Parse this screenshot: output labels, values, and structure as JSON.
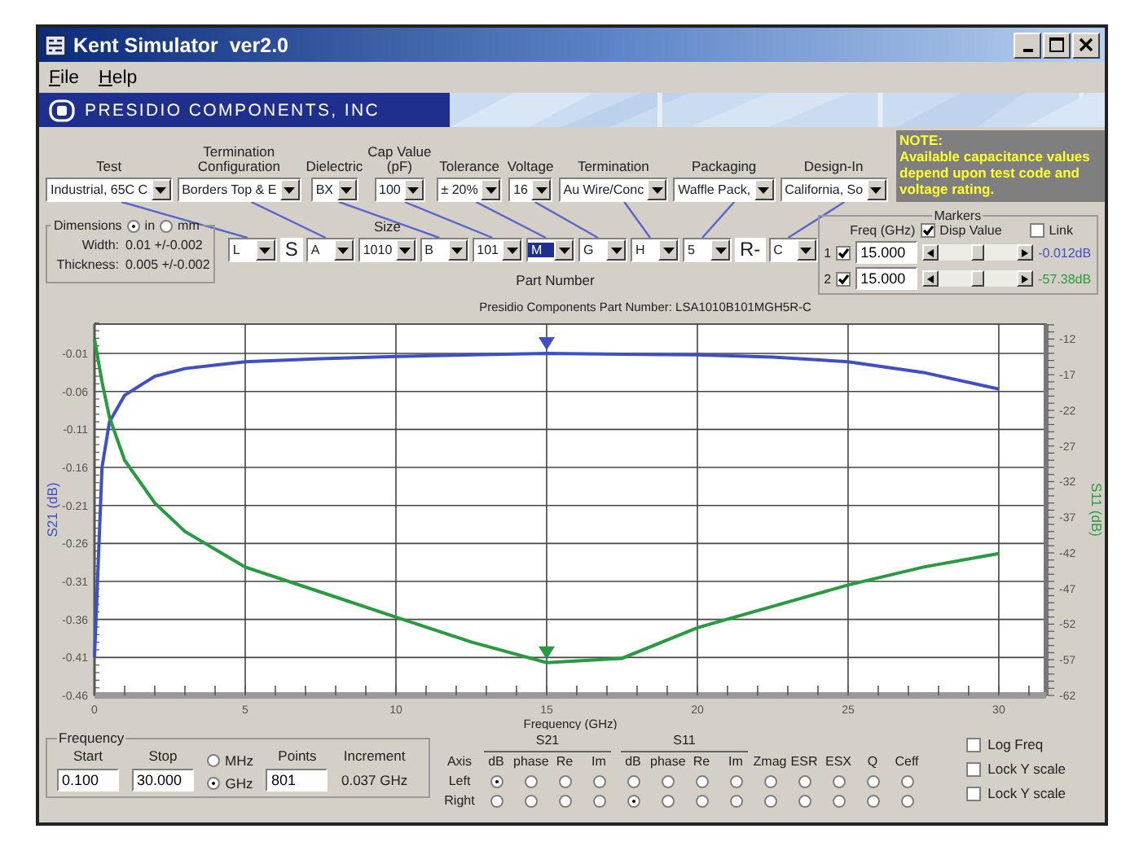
{
  "window": {
    "title": "Kent Simulator  ver2.0"
  },
  "menu": [
    {
      "label": "File"
    },
    {
      "label": "Help"
    }
  ],
  "banner": {
    "company": "PRESIDIO COMPONENTS, INC"
  },
  "selectors": [
    {
      "label": "Test",
      "value": "Industrial, 65C C"
    },
    {
      "label": "Termination\nConfiguration",
      "value": "Borders Top & E"
    },
    {
      "label": "Dielectric",
      "value": "BX"
    },
    {
      "label": "Cap Value\n(pF)",
      "value": "100"
    },
    {
      "label": "Tolerance",
      "value": "± 20%"
    },
    {
      "label": "Voltage",
      "value": "16"
    },
    {
      "label": "Termination",
      "value": "Au Wire/Conc"
    },
    {
      "label": "Packaging",
      "value": "Waffle Pack,"
    },
    {
      "label": "Design-In",
      "value": "California, So"
    }
  ],
  "note": {
    "title": "NOTE:",
    "text": "Available capacitance values depend upon test code and voltage rating."
  },
  "dimensions": {
    "title": "Dimensions",
    "units": [
      {
        "label": "in",
        "selected": true
      },
      {
        "label": "mm",
        "selected": false
      }
    ],
    "rows": [
      {
        "label": "Width:",
        "value": "0.01 +/-0.002"
      },
      {
        "label": "Thickness:",
        "value": "0.005 +/-0.002"
      }
    ]
  },
  "part_number": {
    "label": "Part Number",
    "segments": [
      {
        "kind": "select",
        "value": "L",
        "selected": false
      },
      {
        "kind": "fixed",
        "value": "S"
      },
      {
        "kind": "select",
        "value": "A",
        "selected": false
      },
      {
        "kind": "select",
        "value": "1010",
        "caption": "Size",
        "selected": false
      },
      {
        "kind": "select",
        "value": "B",
        "selected": false
      },
      {
        "kind": "select",
        "value": "101",
        "selected": false
      },
      {
        "kind": "select",
        "value": "M",
        "selected": true
      },
      {
        "kind": "select",
        "value": "G",
        "selected": false
      },
      {
        "kind": "select",
        "value": "H",
        "selected": false
      },
      {
        "kind": "select",
        "value": "5",
        "selected": false
      },
      {
        "kind": "fixed",
        "value": "R-"
      },
      {
        "kind": "select",
        "value": "C",
        "selected": false
      }
    ]
  },
  "markers": {
    "title": "Markers",
    "freq_label": "Freq (GHz)",
    "options": [
      {
        "label": "Disp Value",
        "checked": true
      },
      {
        "label": "Link",
        "checked": false
      }
    ],
    "rows": [
      {
        "index": "1",
        "checked": true,
        "freq": "15.000",
        "level": 0.5,
        "reading": "-0.012dB",
        "color": "#4050c0"
      },
      {
        "index": "2",
        "checked": true,
        "freq": "15.000",
        "level": 0.5,
        "reading": "-57.38dB",
        "color": "#2a9a40"
      }
    ]
  },
  "chart": {
    "title": "Presidio Components Part Number: LSA1010B101MGH5R-C",
    "chart_data": {
      "type": "line",
      "xlabel": "Frequency (GHz)",
      "ylabel": "S21 (dB)",
      "y2label": "S11 (dB)",
      "grid": true,
      "x": [
        0,
        0.25,
        0.5,
        1,
        2,
        3,
        5,
        7.5,
        10,
        12.5,
        15,
        17.5,
        20,
        22.5,
        25,
        27.5,
        30
      ],
      "xlim": [
        0,
        31.57
      ],
      "ylim": [
        -0.46,
        0.0286
      ],
      "xticks": [
        0,
        5,
        10,
        15,
        20,
        25,
        30
      ],
      "yticks": [
        -0.01,
        -0.06,
        -0.11,
        -0.16,
        -0.21,
        -0.26,
        -0.31,
        -0.36,
        -0.41,
        -0.46
      ],
      "y2lim": [
        -62,
        -9.9
      ],
      "y2ticks": [
        -12,
        -17,
        -22,
        -27,
        -32,
        -37,
        -42,
        -47,
        -52,
        -57,
        -62
      ],
      "series": [
        {
          "color": "#4050c0",
          "values": [
            -0.41,
            -0.16,
            -0.1,
            -0.065,
            -0.04,
            -0.03,
            -0.021,
            -0.017,
            -0.014,
            -0.012,
            -0.01,
            -0.011,
            -0.012,
            -0.015,
            -0.021,
            -0.035,
            -0.057
          ]
        },
        {
          "color": "#2a9a40",
          "axis": "y2",
          "values": [
            -12,
            -18,
            -23,
            -29,
            -35,
            -39,
            -44,
            -47.5,
            -51,
            -54.5,
            -57.4,
            -56.8,
            -52.5,
            -49.5,
            -46.5,
            -44,
            -42.1
          ]
        }
      ]
    }
  },
  "frequency": {
    "title": "Frequency",
    "start_label": "Start",
    "start": "0.100",
    "stop_label": "Stop",
    "stop": "30.000",
    "units": [
      {
        "label": "MHz",
        "selected": false
      },
      {
        "label": "GHz",
        "selected": true
      }
    ],
    "points_label": "Points",
    "points": "801",
    "increment_label": "Increment",
    "increment": "0.037 GHz"
  },
  "axis_select": {
    "title": "Axis",
    "groups": [
      {
        "label": "S21",
        "columns": [
          "dB",
          "phase",
          "Re",
          "Im"
        ]
      },
      {
        "label": "S11",
        "columns": [
          "dB",
          "phase",
          "Re",
          "Im"
        ]
      },
      {
        "columns": [
          "Zmag",
          "ESR",
          "ESX",
          "Q",
          "Ceff"
        ]
      }
    ],
    "rows": [
      {
        "label": "Left",
        "choices": [
          {
            "selected": true
          },
          {
            "selected": false
          },
          {
            "selected": false
          },
          {
            "selected": false
          },
          {
            "selected": false
          },
          {
            "selected": false
          },
          {
            "selected": false
          },
          {
            "selected": false
          },
          {
            "selected": false
          },
          {
            "selected": false
          },
          {
            "selected": false
          },
          {
            "selected": false
          },
          {
            "selected": false
          }
        ]
      },
      {
        "label": "Right",
        "choices": [
          {
            "selected": false
          },
          {
            "selected": false
          },
          {
            "selected": false
          },
          {
            "selected": false
          },
          {
            "selected": true
          },
          {
            "selected": false
          },
          {
            "selected": false
          },
          {
            "selected": false
          },
          {
            "selected": false
          },
          {
            "selected": false
          },
          {
            "selected": false
          },
          {
            "selected": false
          },
          {
            "selected": false
          }
        ]
      }
    ]
  },
  "options": [
    {
      "label": "Log Freq",
      "checked": false
    },
    {
      "label": "Lock Y scale",
      "checked": false
    },
    {
      "label": "Lock Y scale",
      "checked": false
    }
  ]
}
